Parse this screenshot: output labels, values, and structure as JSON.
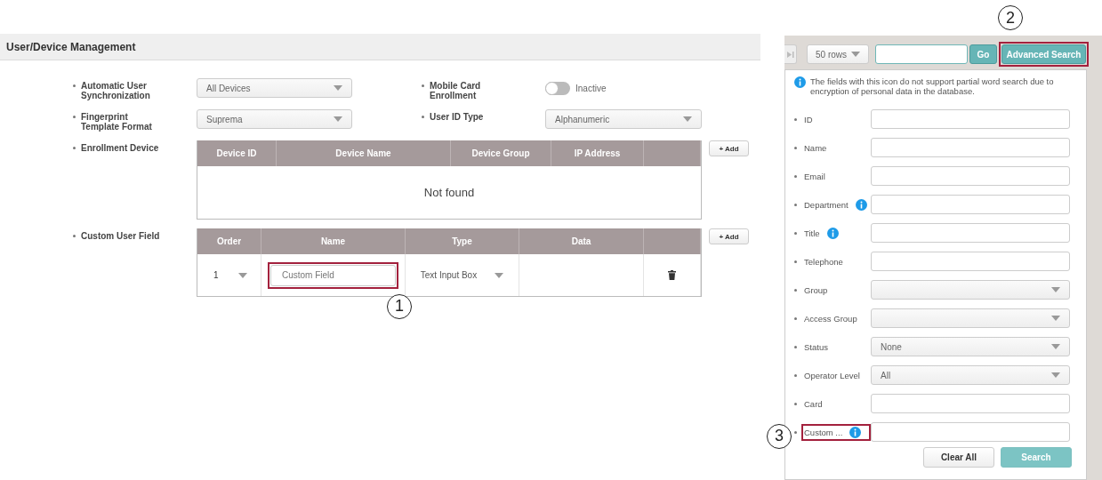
{
  "page_title": "User/Device Management",
  "settings": [
    {
      "kind": "select",
      "label": "Automatic User Synchronization",
      "value": "All Devices"
    },
    {
      "kind": "toggle",
      "label": "Mobile Card Enrollment",
      "on": false,
      "status": "Inactive"
    },
    {
      "kind": "select",
      "label": "Fingerprint Template Format",
      "value": "Suprema"
    },
    {
      "kind": "select",
      "label": "User ID Type",
      "value": "Alphanumeric"
    }
  ],
  "enrollment_device": {
    "label": "Enrollment Device",
    "columns": [
      "Device ID",
      "Device Name",
      "Device Group",
      "IP Address"
    ],
    "empty_text": "Not found",
    "add_button": "+ Add"
  },
  "custom_user_field": {
    "label": "Custom User Field",
    "columns": [
      "Order",
      "Name",
      "Type",
      "Data"
    ],
    "add_button": "+ Add",
    "rows": [
      {
        "order": "1",
        "name": "Custom Field",
        "type": "Text Input Box",
        "callout": "1"
      }
    ]
  },
  "toolbar": {
    "rows_select": "50 rows",
    "go_button": "Go",
    "advanced_button": {
      "label": "Advanced Search",
      "callout": "2"
    }
  },
  "advanced_search": {
    "note": "The fields with this icon do not support partial word search due to encryption of personal data in the database.",
    "fields": [
      {
        "kind": "text",
        "label": "ID",
        "encrypted": false
      },
      {
        "kind": "text",
        "label": "Name",
        "encrypted": false
      },
      {
        "kind": "text",
        "label": "Email",
        "encrypted": false
      },
      {
        "kind": "text",
        "label": "Department",
        "encrypted": true
      },
      {
        "kind": "text",
        "label": "Title",
        "encrypted": true
      },
      {
        "kind": "text",
        "label": "Telephone",
        "encrypted": false
      },
      {
        "kind": "select",
        "label": "Group",
        "encrypted": false
      },
      {
        "kind": "select",
        "label": "Access Group",
        "encrypted": false
      },
      {
        "kind": "select",
        "label": "Status",
        "value": "None",
        "encrypted": false
      },
      {
        "kind": "select",
        "label": "Operator Level",
        "value": "All",
        "encrypted": false
      },
      {
        "kind": "text",
        "label": "Card",
        "encrypted": false
      },
      {
        "kind": "text",
        "label": "Custom ...",
        "encrypted": true,
        "callout": "3"
      }
    ],
    "buttons": [
      {
        "label": "Clear All",
        "primary": false
      },
      {
        "label": "Search",
        "primary": true
      }
    ]
  }
}
